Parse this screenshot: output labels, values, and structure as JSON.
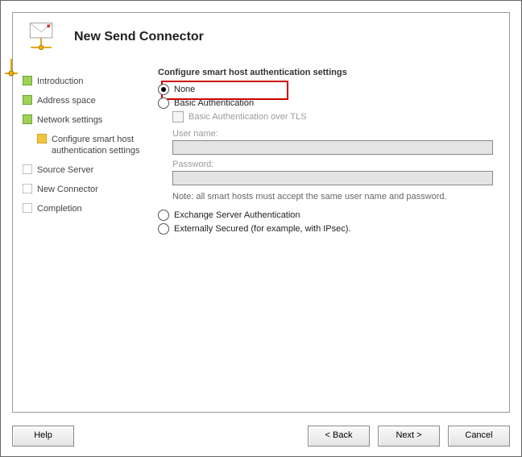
{
  "header": {
    "title": "New Send Connector"
  },
  "sidebar": {
    "items": [
      {
        "label": "Introduction",
        "state": "done"
      },
      {
        "label": "Address space",
        "state": "done"
      },
      {
        "label": "Network settings",
        "state": "done"
      },
      {
        "label": "Configure smart host authentication settings",
        "state": "current"
      },
      {
        "label": "Source Server",
        "state": "pending"
      },
      {
        "label": "New Connector",
        "state": "pending"
      },
      {
        "label": "Completion",
        "state": "pending"
      }
    ]
  },
  "main": {
    "heading": "Configure smart host authentication settings",
    "radios": {
      "none": {
        "label": "None",
        "checked": true
      },
      "basic": {
        "label": "Basic Authentication",
        "checked": false
      },
      "basicTls": {
        "label": "Basic Authentication over TLS",
        "checked": false
      },
      "exchange": {
        "label": "Exchange Server Authentication",
        "checked": false
      },
      "external": {
        "label": "Externally Secured (for example, with IPsec).",
        "checked": false
      }
    },
    "fields": {
      "username": {
        "label": "User name:",
        "value": ""
      },
      "password": {
        "label": "Password:",
        "value": ""
      }
    },
    "note": "Note: all smart hosts must accept the same user name and password."
  },
  "buttons": {
    "help": "Help",
    "back": "< Back",
    "next": "Next >",
    "cancel": "Cancel"
  }
}
